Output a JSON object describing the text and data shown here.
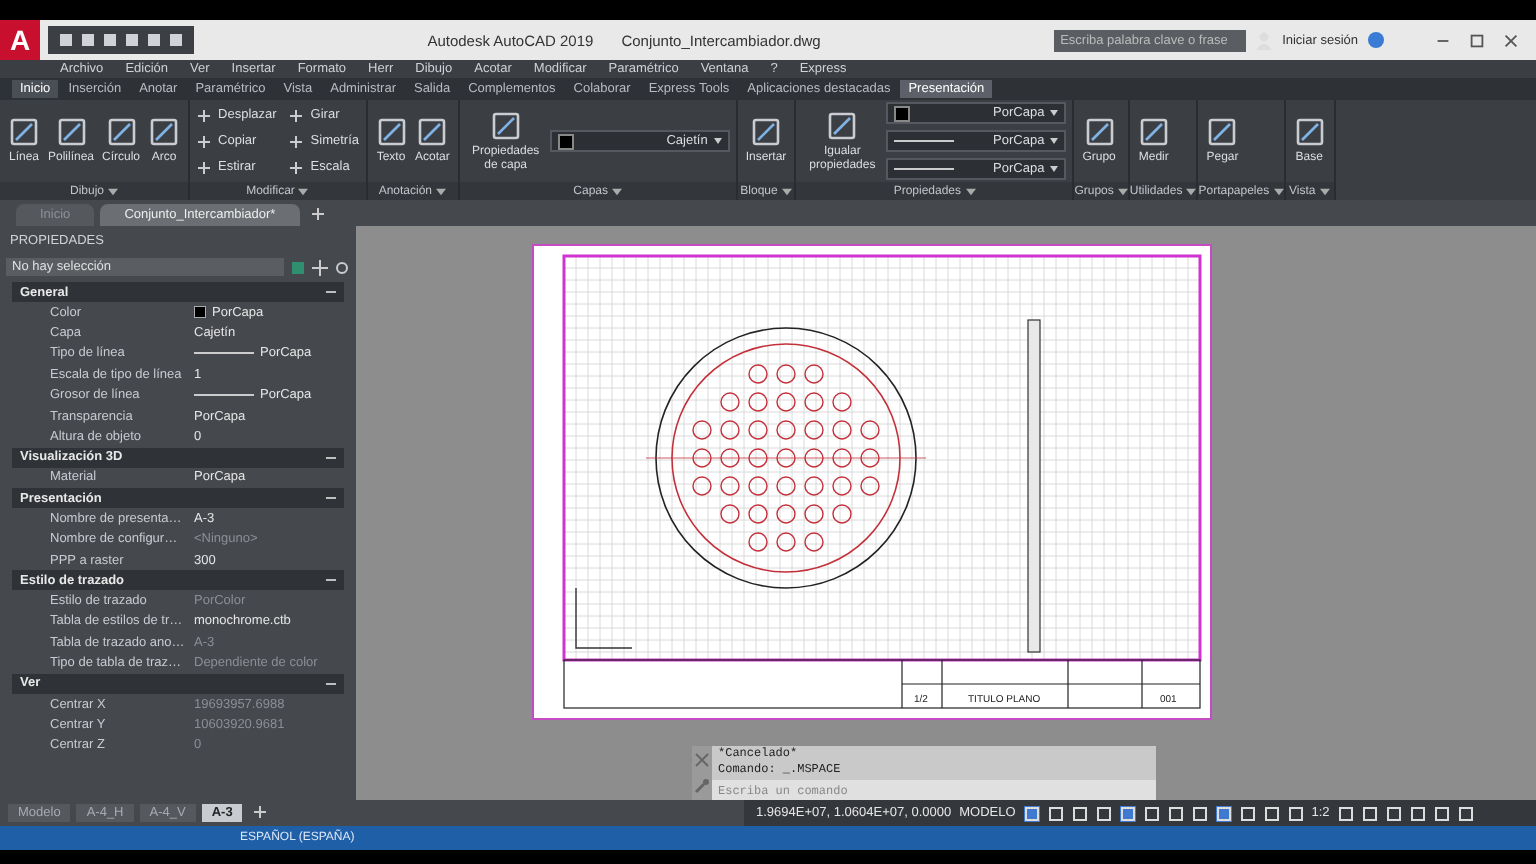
{
  "title_bar": {
    "logo": "A",
    "app_title": "Autodesk AutoCAD 2019",
    "file_name": "Conjunto_Intercambiador.dwg",
    "search": {
      "placeholder": "Escriba palabra clave o frase"
    },
    "sign_in": "Iniciar sesión"
  },
  "menu_bar": [
    "Archivo",
    "Edición",
    "Ver",
    "Insertar",
    "Formato",
    "Herr",
    "Dibujo",
    "Acotar",
    "Modificar",
    "Paramétrico",
    "Ventana",
    "?",
    "Express"
  ],
  "ribbon_tabs": [
    {
      "label": "Inicio",
      "selected": true,
      "contextual": false
    },
    {
      "label": "Inserción",
      "selected": false,
      "contextual": false
    },
    {
      "label": "Anotar",
      "selected": false,
      "contextual": false
    },
    {
      "label": "Paramétrico",
      "selected": false,
      "contextual": false
    },
    {
      "label": "Vista",
      "selected": false,
      "contextual": false
    },
    {
      "label": "Administrar",
      "selected": false,
      "contextual": false
    },
    {
      "label": "Salida",
      "selected": false,
      "contextual": false
    },
    {
      "label": "Complementos",
      "selected": false,
      "contextual": false
    },
    {
      "label": "Colaborar",
      "selected": false,
      "contextual": false
    },
    {
      "label": "Express Tools",
      "selected": false,
      "contextual": false
    },
    {
      "label": "Aplicaciones destacadas",
      "selected": false,
      "contextual": false
    },
    {
      "label": "Presentación",
      "selected": false,
      "contextual": true
    }
  ],
  "ribbon_panels": [
    {
      "label": "Dibujo",
      "tools": [
        {
          "label": "Línea",
          "kind": "large"
        },
        {
          "label": "Polilínea",
          "kind": "large"
        },
        {
          "label": "Círculo",
          "kind": "large"
        },
        {
          "label": "Arco",
          "kind": "large"
        }
      ]
    },
    {
      "label": "Modificar",
      "tools": [
        {
          "label": "Desplazar",
          "kind": "small"
        },
        {
          "label": "Copiar",
          "kind": "small"
        },
        {
          "label": "Estirar",
          "kind": "small"
        },
        {
          "label": "Girar",
          "kind": "small"
        },
        {
          "label": "Simetría",
          "kind": "small"
        },
        {
          "label": "Escala",
          "kind": "small"
        }
      ]
    },
    {
      "label": "Anotación",
      "tools": [
        {
          "label": "Texto",
          "kind": "large"
        },
        {
          "label": "Acotar",
          "kind": "large"
        }
      ]
    },
    {
      "label": "Capas",
      "tools": [
        {
          "label": "Propiedades de capa",
          "kind": "large"
        },
        {
          "label": "Cajetín",
          "kind": "color_dropdown"
        }
      ]
    },
    {
      "label": "Bloque",
      "tools": [
        {
          "label": "Insertar",
          "kind": "large"
        }
      ]
    },
    {
      "label": "Propiedades",
      "tools": [
        {
          "label": "Igualar propiedades",
          "kind": "large"
        },
        {
          "label": "PorCapa",
          "kind": "color_dropdown"
        },
        {
          "label": "PorCapa",
          "kind": "line_dropdown"
        },
        {
          "label": "PorCapa",
          "kind": "line_dropdown"
        }
      ]
    },
    {
      "label": "Grupos",
      "tools": [
        {
          "label": "Grupo",
          "kind": "large"
        }
      ]
    },
    {
      "label": "Utilidades",
      "tools": [
        {
          "label": "Medir",
          "kind": "large"
        }
      ]
    },
    {
      "label": "Portapapeles",
      "tools": [
        {
          "label": "Pegar",
          "kind": "large"
        }
      ]
    },
    {
      "label": "Vista",
      "tools": [
        {
          "label": "Base",
          "kind": "large"
        }
      ]
    }
  ],
  "file_tabs": [
    {
      "label": "Inicio",
      "selected": false
    },
    {
      "label": "Conjunto_Intercambiador*",
      "selected": true
    }
  ],
  "properties": {
    "title": "PROPIEDADES",
    "selection": "No hay selección",
    "sections": [
      {
        "title": "General",
        "rows": [
          {
            "label": "Color",
            "value": "PorCapa",
            "kind": "color",
            "disabled": false
          },
          {
            "label": "Capa",
            "value": "Cajetín",
            "kind": "text",
            "disabled": false
          },
          {
            "label": "Tipo de línea",
            "value": "PorCapa",
            "kind": "line",
            "disabled": false
          },
          {
            "label": "Escala de tipo de línea",
            "value": "1",
            "kind": "text",
            "disabled": false
          },
          {
            "label": "Grosor de línea",
            "value": "PorCapa",
            "kind": "line",
            "disabled": false
          },
          {
            "label": "Transparencia",
            "value": "PorCapa",
            "kind": "text",
            "disabled": false
          },
          {
            "label": "Altura de objeto",
            "value": "0",
            "kind": "text",
            "disabled": false
          }
        ]
      },
      {
        "title": "Visualización 3D",
        "rows": [
          {
            "label": "Material",
            "value": "PorCapa",
            "kind": "text",
            "disabled": false
          }
        ]
      },
      {
        "title": "Presentación",
        "rows": [
          {
            "label": "Nombre de presenta…",
            "value": "A-3",
            "kind": "text",
            "disabled": false
          },
          {
            "label": "Nombre de configur…",
            "value": "<Ninguno>",
            "kind": "text",
            "disabled": true
          },
          {
            "label": "PPP a raster",
            "value": "300",
            "kind": "text",
            "disabled": false
          }
        ]
      },
      {
        "title": "Estilo de trazado",
        "rows": [
          {
            "label": "Estilo de trazado",
            "value": "PorColor",
            "kind": "text",
            "disabled": true
          },
          {
            "label": "Tabla de estilos de tr…",
            "value": "monochrome.ctb",
            "kind": "text",
            "disabled": false
          },
          {
            "label": "Tabla de trazado ano…",
            "value": "A-3",
            "kind": "text",
            "disabled": true
          },
          {
            "label": "Tipo de tabla de traz…",
            "value": "Dependiente de color",
            "kind": "text",
            "disabled": true
          }
        ]
      },
      {
        "title": "Ver",
        "rows": [
          {
            "label": "Centrar X",
            "value": "19693957.6988",
            "kind": "text",
            "disabled": true
          },
          {
            "label": "Centrar Y",
            "value": "10603920.9681",
            "kind": "text",
            "disabled": true
          },
          {
            "label": "Centrar Z",
            "value": "0",
            "kind": "text",
            "disabled": true
          }
        ]
      }
    ]
  },
  "drawing": {
    "title_block": {
      "title": "TITULO PLANO",
      "sheet": "1/2",
      "number": "001"
    }
  },
  "command_line": {
    "history": [
      "*Cancelado*",
      "Comando:  _.MSPACE"
    ],
    "placeholder": "Escriba un comando"
  },
  "layout_tabs": [
    {
      "label": "Modelo",
      "selected": false
    },
    {
      "label": "A-4_H",
      "selected": false
    },
    {
      "label": "A-4_V",
      "selected": false
    },
    {
      "label": "A-3",
      "selected": true
    }
  ],
  "status_bar": {
    "coordinates": "1.9694E+07, 1.0604E+07, 0.0000",
    "space": "MODELO",
    "scale": "1:2"
  },
  "taskbar": {
    "language": "ESPAÑOL (ESPAÑA)"
  }
}
